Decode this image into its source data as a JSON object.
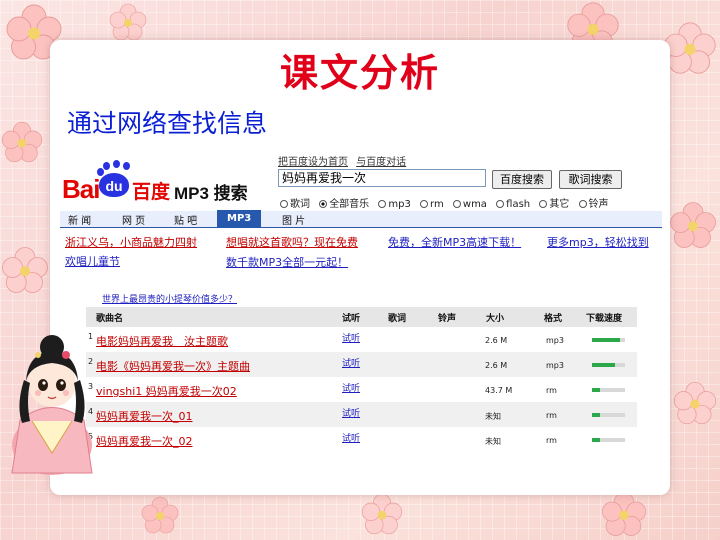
{
  "slide": {
    "title": "课文分析",
    "subtitle": "通过网络查找信息"
  },
  "baidu": {
    "logo_bai": "Bai",
    "logo_du": "du",
    "logo_cn": "百度",
    "logo_mp3": "MP3 搜索",
    "top_links": [
      "把百度设为首页",
      "与百度对话"
    ],
    "search_value": "妈妈再爱我一次",
    "search_button": "百度搜索",
    "lyrics_button": "歌词搜索",
    "radio_options": [
      {
        "label": "歌词",
        "selected": false
      },
      {
        "label": "全部音乐",
        "selected": true
      },
      {
        "label": "mp3",
        "selected": false
      },
      {
        "label": "rm",
        "selected": false
      },
      {
        "label": "wma",
        "selected": false
      },
      {
        "label": "flash",
        "selected": false
      },
      {
        "label": "其它",
        "selected": false
      },
      {
        "label": "铃声",
        "selected": false
      }
    ],
    "tabs": [
      "新 闻",
      "网 页",
      "贴 吧",
      "MP3",
      "图 片"
    ],
    "active_tab": "MP3",
    "ads": [
      "浙江义乌，小商品魅力四射",
      "想唱就这首歌吗？现在免费",
      "免费，全新MP3高速下载！",
      "更多mp3，轻松找到",
      "欢唱儿童节",
      "数千款MP3全部一元起！"
    ],
    "small_link": "世界上最昂贵的小提琴价值多少？",
    "table": {
      "headers": [
        "歌曲名",
        "试听",
        "歌词",
        "铃声",
        "大小",
        "格式",
        "下载速度"
      ],
      "rows": [
        {
          "num": "1",
          "song": "电影妈妈再爱我　汝主题歌",
          "listen": "试听",
          "size": "2.6 M",
          "format": "mp3",
          "speed": 0.85
        },
        {
          "num": "2",
          "song": "电影《妈妈再爱我一次》主题曲",
          "listen": "试听",
          "size": "2.6 M",
          "format": "mp3",
          "speed": 0.7
        },
        {
          "num": "3",
          "song": "vingshi1 妈妈再爱我一次02",
          "listen": "试听",
          "size": "43.7 M",
          "format": "rm",
          "speed": 0.25
        },
        {
          "num": "4",
          "song": "妈妈再爱我一次_01",
          "listen": "试听",
          "size": "未知",
          "format": "rm",
          "speed": 0.25
        },
        {
          "num": "5",
          "song": "妈妈再爱我一次_02",
          "listen": "试听",
          "size": "未知",
          "format": "rm",
          "speed": 0.25
        }
      ]
    }
  },
  "colors": {
    "title_red": "#e0001a",
    "subtitle_blue": "#0a1fd4",
    "baidu_red": "#e10602",
    "baidu_blue": "#2932e1",
    "speed_green": "#2aa84a"
  }
}
